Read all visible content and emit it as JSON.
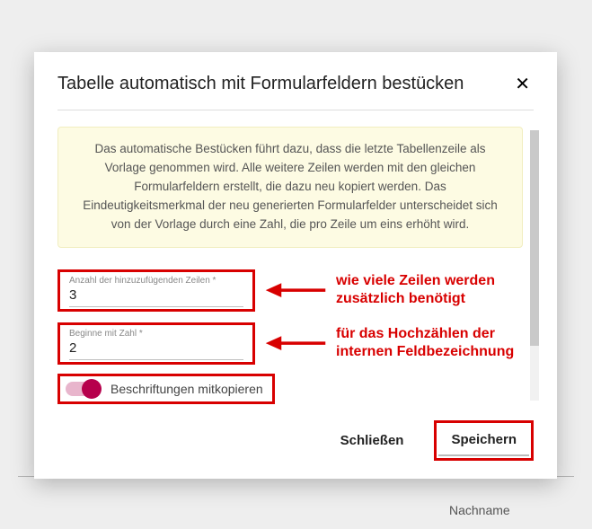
{
  "background": {
    "column_label": "Nachname"
  },
  "dialog": {
    "title": "Tabelle automatisch mit Formularfeldern bestücken",
    "info": "Das automatische Bestücken führt dazu, dass die letzte Tabellenzeile als Vorlage genommen wird. Alle weitere Zeilen werden mit den gleichen Formularfeldern erstellt, die dazu neu kopiert werden. Das Eindeutigkeitsmerkmal der neu generierten Formularfelder unterscheidet sich von der Vorlage durch eine Zahl, die pro Zeile um eins erhöht wird.",
    "fields": {
      "rows": {
        "label": "Anzahl der hinzuzufügenden Zeilen *",
        "value": "3"
      },
      "start": {
        "label": "Beginne mit Zahl *",
        "value": "2"
      }
    },
    "toggle": {
      "label": "Beschriftungen mitkopieren",
      "on": true
    },
    "actions": {
      "close": "Schließen",
      "save": "Speichern"
    }
  },
  "annotations": {
    "rows": "wie viele Zeilen werden zusätzlich benötigt",
    "start": "für das Hochzählen der internen Feldbezeichnung"
  },
  "colors": {
    "highlight": "#d80000",
    "accent": "#b6004c"
  }
}
